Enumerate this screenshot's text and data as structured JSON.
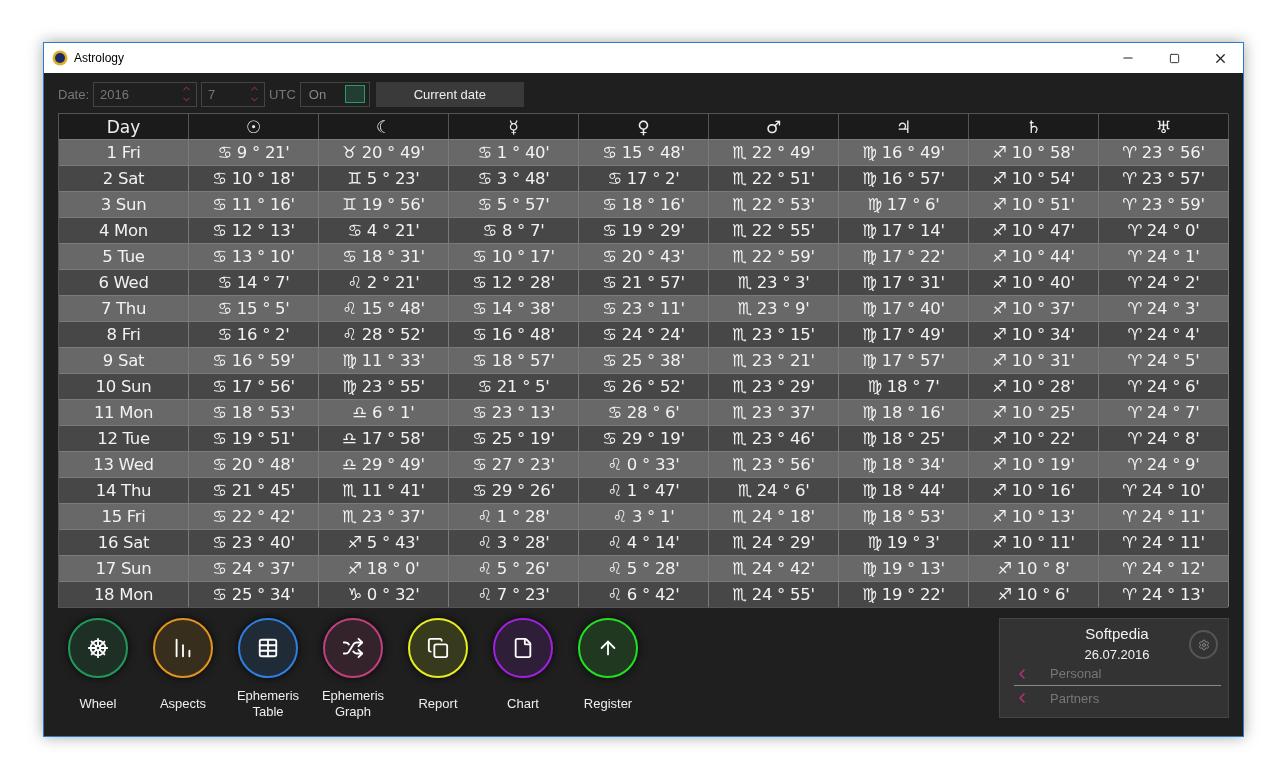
{
  "window": {
    "title": "Astrology"
  },
  "toolbar": {
    "date_label": "Date:",
    "year": "2016",
    "month": "7",
    "utc_label": "UTC",
    "utc_toggle": {
      "label": "On",
      "on": true
    },
    "current_date_button": "Current date"
  },
  "table": {
    "columns": [
      "Day",
      "☉",
      "☾",
      "☿",
      "♀",
      "♂",
      "♃",
      "♄",
      "♅"
    ],
    "rows": [
      [
        "1 Fri",
        "♋ 9 ° 21'",
        "♉ 20 ° 49'",
        "♋ 1 ° 40'",
        "♋ 15 ° 48'",
        "♏ 22 ° 49'",
        "♍ 16 ° 49'",
        "♐ 10 ° 58'",
        "♈ 23 ° 56'"
      ],
      [
        "2 Sat",
        "♋ 10 ° 18'",
        "♊ 5 ° 23'",
        "♋ 3 ° 48'",
        "♋ 17 ° 2'",
        "♏ 22 ° 51'",
        "♍ 16 ° 57'",
        "♐ 10 ° 54'",
        "♈ 23 ° 57'"
      ],
      [
        "3 Sun",
        "♋ 11 ° 16'",
        "♊ 19 ° 56'",
        "♋ 5 ° 57'",
        "♋ 18 ° 16'",
        "♏ 22 ° 53'",
        "♍ 17 ° 6'",
        "♐ 10 ° 51'",
        "♈ 23 ° 59'"
      ],
      [
        "4 Mon",
        "♋ 12 ° 13'",
        "♋ 4 ° 21'",
        "♋ 8 ° 7'",
        "♋ 19 ° 29'",
        "♏ 22 ° 55'",
        "♍ 17 ° 14'",
        "♐ 10 ° 47'",
        "♈ 24 ° 0'"
      ],
      [
        "5 Tue",
        "♋ 13 ° 10'",
        "♋ 18 ° 31'",
        "♋ 10 ° 17'",
        "♋ 20 ° 43'",
        "♏ 22 ° 59'",
        "♍ 17 ° 22'",
        "♐ 10 ° 44'",
        "♈ 24 ° 1'"
      ],
      [
        "6 Wed",
        "♋ 14 ° 7'",
        "♌ 2 ° 21'",
        "♋ 12 ° 28'",
        "♋ 21 ° 57'",
        "♏ 23 ° 3'",
        "♍ 17 ° 31'",
        "♐ 10 ° 40'",
        "♈ 24 ° 2'"
      ],
      [
        "7 Thu",
        "♋ 15 ° 5'",
        "♌ 15 ° 48'",
        "♋ 14 ° 38'",
        "♋ 23 ° 11'",
        "♏ 23 ° 9'",
        "♍ 17 ° 40'",
        "♐ 10 ° 37'",
        "♈ 24 ° 3'"
      ],
      [
        "8 Fri",
        "♋ 16 ° 2'",
        "♌ 28 ° 52'",
        "♋ 16 ° 48'",
        "♋ 24 ° 24'",
        "♏ 23 ° 15'",
        "♍ 17 ° 49'",
        "♐ 10 ° 34'",
        "♈ 24 ° 4'"
      ],
      [
        "9 Sat",
        "♋ 16 ° 59'",
        "♍ 11 ° 33'",
        "♋ 18 ° 57'",
        "♋ 25 ° 38'",
        "♏ 23 ° 21'",
        "♍ 17 ° 57'",
        "♐ 10 ° 31'",
        "♈ 24 ° 5'"
      ],
      [
        "10 Sun",
        "♋ 17 ° 56'",
        "♍ 23 ° 55'",
        "♋ 21 ° 5'",
        "♋ 26 ° 52'",
        "♏ 23 ° 29'",
        "♍ 18 ° 7'",
        "♐ 10 ° 28'",
        "♈ 24 ° 6'"
      ],
      [
        "11 Mon",
        "♋ 18 ° 53'",
        "♎ 6 ° 1'",
        "♋ 23 ° 13'",
        "♋ 28 ° 6'",
        "♏ 23 ° 37'",
        "♍ 18 ° 16'",
        "♐ 10 ° 25'",
        "♈ 24 ° 7'"
      ],
      [
        "12 Tue",
        "♋ 19 ° 51'",
        "♎ 17 ° 58'",
        "♋ 25 ° 19'",
        "♋ 29 ° 19'",
        "♏ 23 ° 46'",
        "♍ 18 ° 25'",
        "♐ 10 ° 22'",
        "♈ 24 ° 8'"
      ],
      [
        "13 Wed",
        "♋ 20 ° 48'",
        "♎ 29 ° 49'",
        "♋ 27 ° 23'",
        "♌ 0 ° 33'",
        "♏ 23 ° 56'",
        "♍ 18 ° 34'",
        "♐ 10 ° 19'",
        "♈ 24 ° 9'"
      ],
      [
        "14 Thu",
        "♋ 21 ° 45'",
        "♏ 11 ° 41'",
        "♋ 29 ° 26'",
        "♌ 1 ° 47'",
        "♏ 24 ° 6'",
        "♍ 18 ° 44'",
        "♐ 10 ° 16'",
        "♈ 24 ° 10'"
      ],
      [
        "15 Fri",
        "♋ 22 ° 42'",
        "♏ 23 ° 37'",
        "♌ 1 ° 28'",
        "♌ 3 ° 1'",
        "♏ 24 ° 18'",
        "♍ 18 ° 53'",
        "♐ 10 ° 13'",
        "♈ 24 ° 11'"
      ],
      [
        "16 Sat",
        "♋ 23 ° 40'",
        "♐ 5 ° 43'",
        "♌ 3 ° 28'",
        "♌ 4 ° 14'",
        "♏ 24 ° 29'",
        "♍ 19 ° 3'",
        "♐ 10 ° 11'",
        "♈ 24 ° 11'"
      ],
      [
        "17 Sun",
        "♋ 24 ° 37'",
        "♐ 18 ° 0'",
        "♌ 5 ° 26'",
        "♌ 5 ° 28'",
        "♏ 24 ° 42'",
        "♍ 19 ° 13'",
        "♐ 10 ° 8'",
        "♈ 24 ° 12'"
      ],
      [
        "18 Mon",
        "♋ 25 ° 34'",
        "♑ 0 ° 32'",
        "♌ 7 ° 23'",
        "♌ 6 ° 42'",
        "♏ 24 ° 55'",
        "♍ 19 ° 22'",
        "♐ 10 ° 6'",
        "♈ 24 ° 13'"
      ]
    ]
  },
  "nav_buttons": [
    {
      "label": "Wheel",
      "kind": "wheel",
      "color": "#1f9a5a"
    },
    {
      "label": "Aspects",
      "kind": "aspects",
      "color": "#e0961e"
    },
    {
      "label": "Ephemeris Table",
      "kind": "table",
      "color": "#2f7fe0"
    },
    {
      "label": "Ephemeris Graph",
      "kind": "graph",
      "color": "#c0407f"
    },
    {
      "label": "Report",
      "kind": "report",
      "color": "#e4ee20"
    },
    {
      "label": "Chart",
      "kind": "chart",
      "color": "#a020e0"
    },
    {
      "label": "Register",
      "kind": "register",
      "color": "#22e022"
    }
  ],
  "profile": {
    "name": "Softpedia",
    "date": "26.07.2016",
    "items": [
      "Personal",
      "Partners"
    ]
  }
}
